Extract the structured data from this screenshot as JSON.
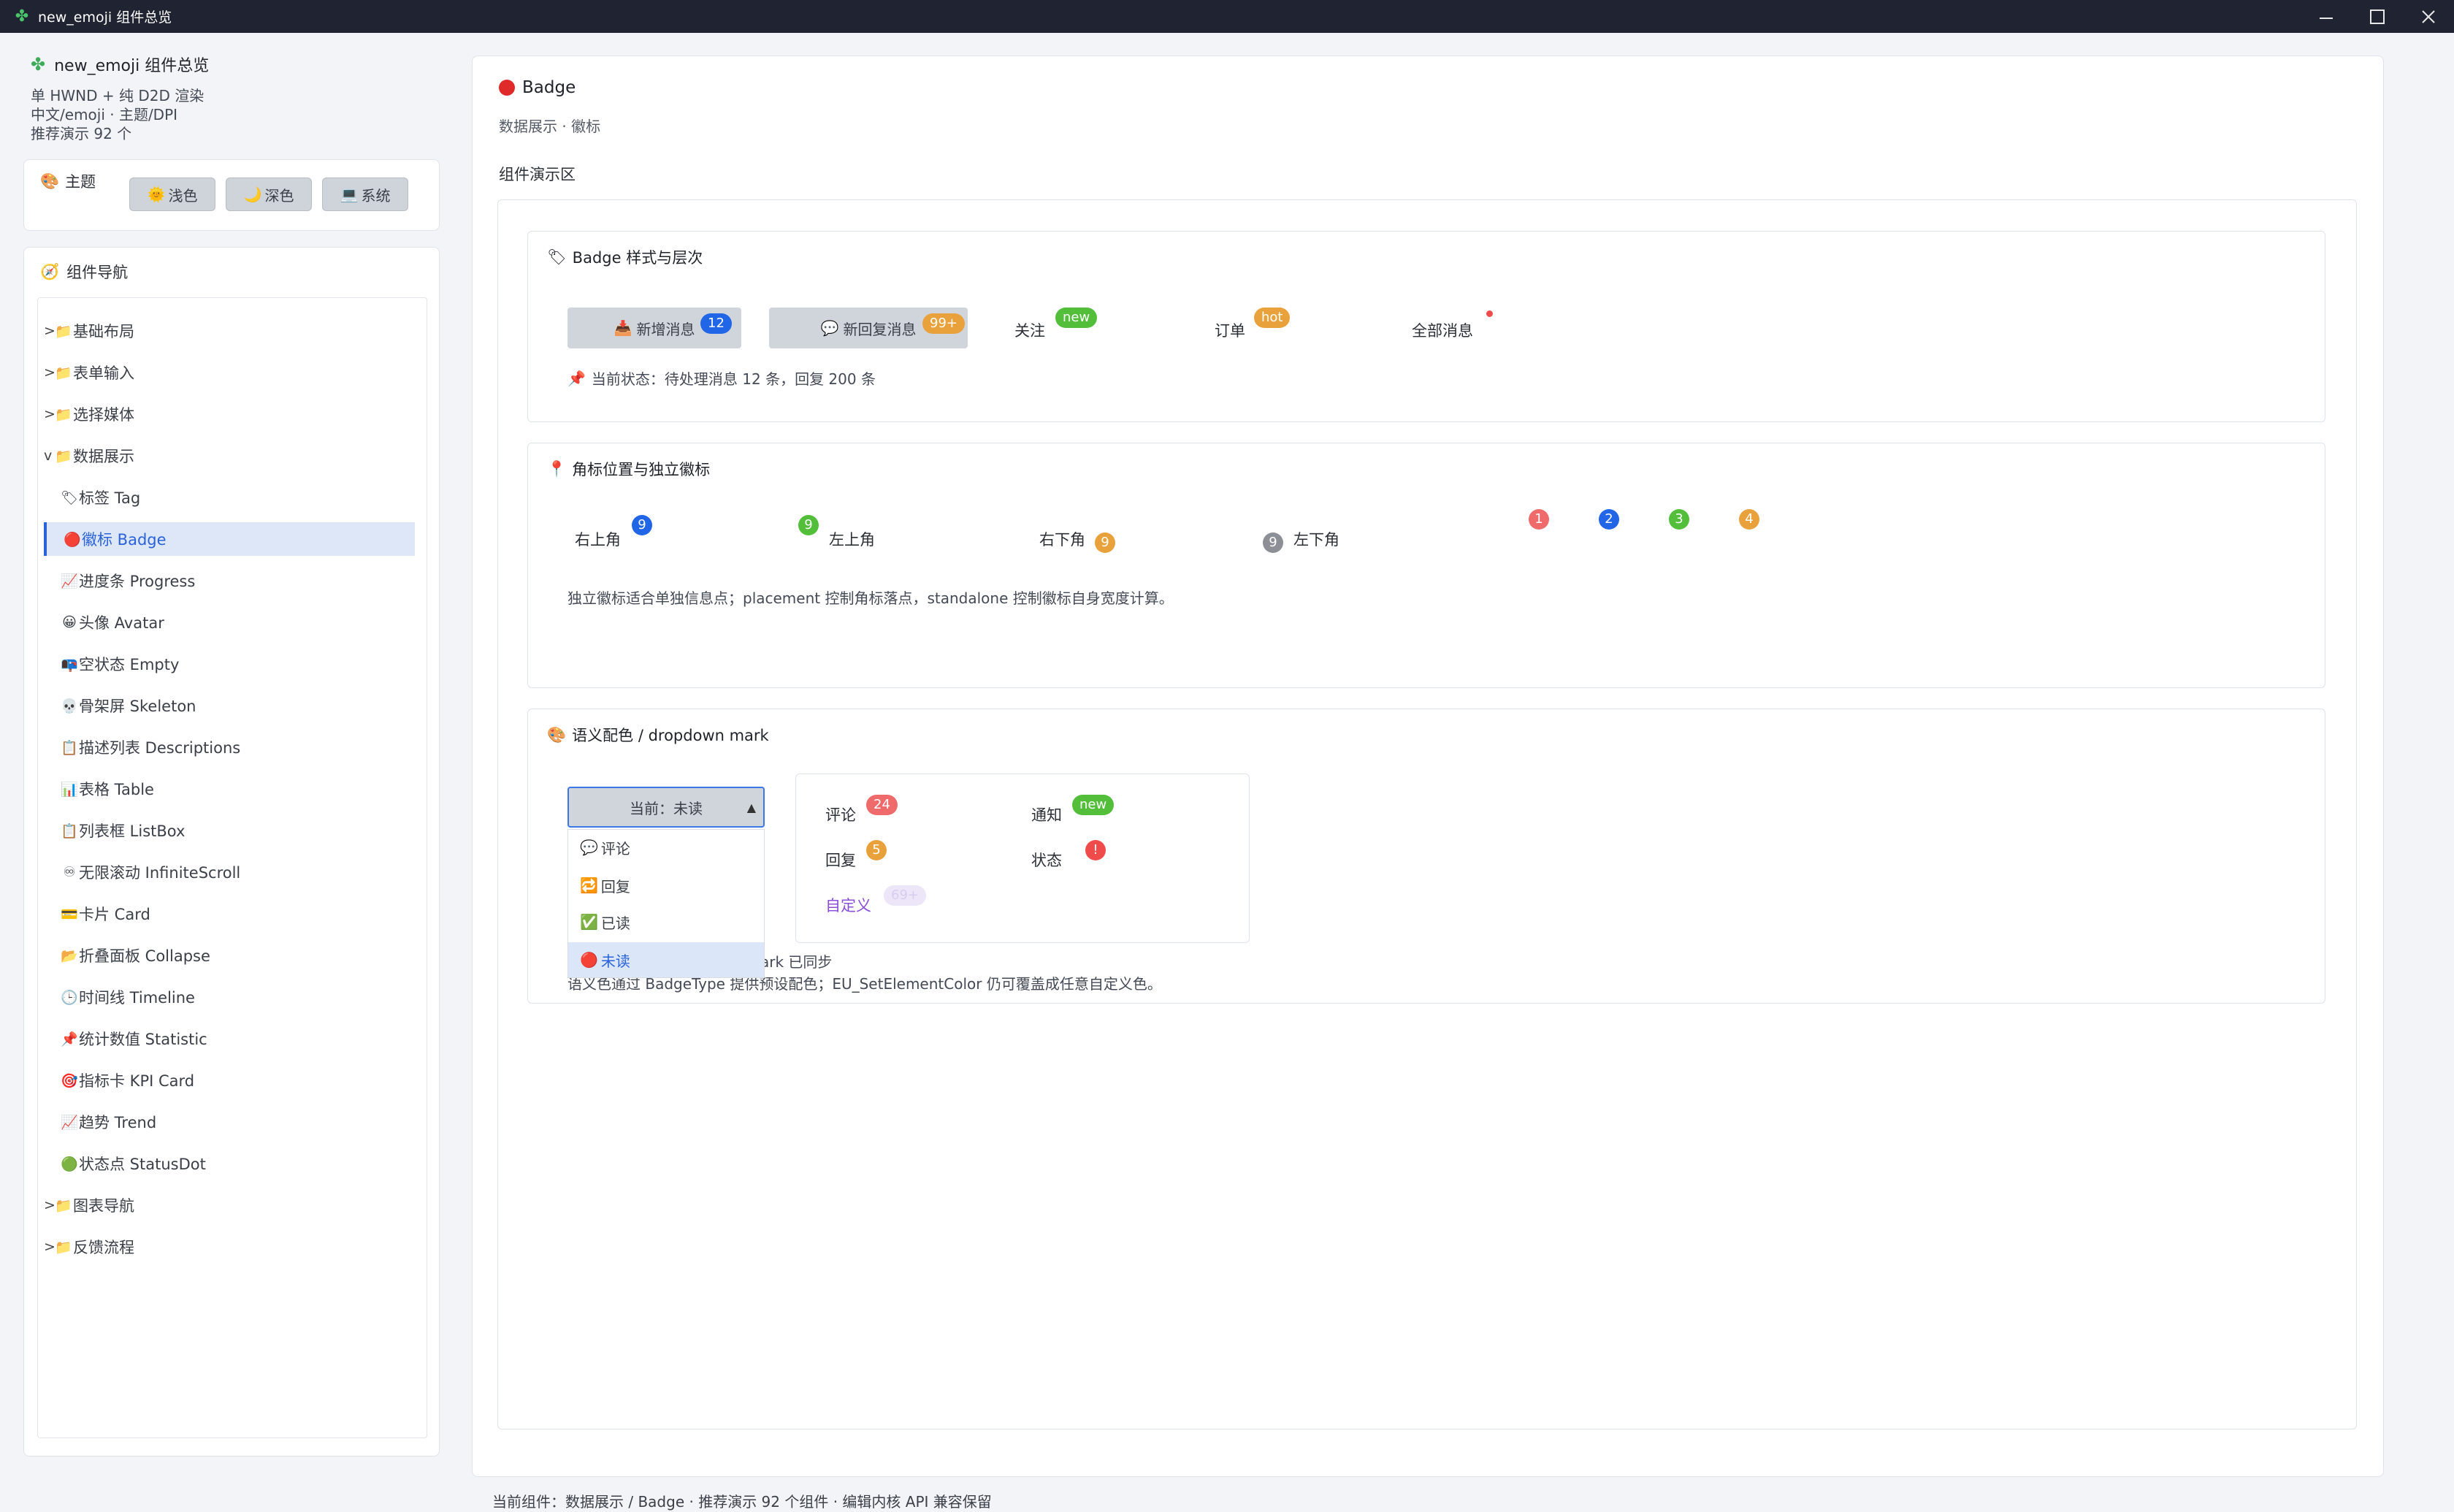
{
  "window": {
    "title": "new_emoji 组件总览",
    "controls": {
      "minimize": "—",
      "maximize": "☐",
      "close": "✕"
    }
  },
  "sidebar": {
    "app_name": "new_emoji 组件总览",
    "lines": [
      "单 HWND + 纯 D2D 渲染",
      "中文/emoji · 主题/DPI",
      "推荐演示 92 个"
    ],
    "theme": {
      "label": "主题",
      "buttons": [
        {
          "icon": "🌞",
          "label": "浅色"
        },
        {
          "icon": "🌙",
          "label": "深色"
        },
        {
          "icon": "💻",
          "label": "系统"
        }
      ]
    },
    "nav": {
      "title": "组件导航",
      "items": [
        {
          "chev": ">",
          "icon": "📁",
          "label": "基础布局"
        },
        {
          "chev": ">",
          "icon": "📁",
          "label": "表单输入"
        },
        {
          "chev": ">",
          "icon": "📁",
          "label": "选择媒体"
        },
        {
          "chev": "v",
          "icon": "📁",
          "label": "数据展示"
        },
        {
          "chev": "",
          "icon": "🏷",
          "label": "标签 Tag"
        },
        {
          "chev": "",
          "icon": "🔴",
          "label": "徽标 Badge"
        },
        {
          "chev": "",
          "icon": "📈",
          "label": "进度条 Progress"
        },
        {
          "chev": "",
          "icon": "😀",
          "label": "头像 Avatar"
        },
        {
          "chev": "",
          "icon": "📭",
          "label": "空状态 Empty"
        },
        {
          "chev": "",
          "icon": "💀",
          "label": "骨架屏 Skeleton"
        },
        {
          "chev": "",
          "icon": "📋",
          "label": "描述列表 Descriptions"
        },
        {
          "chev": "",
          "icon": "📊",
          "label": "表格 Table"
        },
        {
          "chev": "",
          "icon": "📋",
          "label": "列表框 ListBox"
        },
        {
          "chev": "",
          "icon": "♾",
          "label": "无限滚动 InfiniteScroll"
        },
        {
          "chev": "",
          "icon": "💳",
          "label": "卡片 Card"
        },
        {
          "chev": "",
          "icon": "📂",
          "label": "折叠面板 Collapse"
        },
        {
          "chev": "",
          "icon": "🕒",
          "label": "时间线 Timeline"
        },
        {
          "chev": "",
          "icon": "📌",
          "label": "统计数值 Statistic"
        },
        {
          "chev": "",
          "icon": "🎯",
          "label": "指标卡 KPI Card"
        },
        {
          "chev": "",
          "icon": "📈",
          "label": "趋势 Trend"
        },
        {
          "chev": "",
          "icon": "🟢",
          "label": "状态点 StatusDot"
        },
        {
          "chev": ">",
          "icon": "📁",
          "label": "图表导航"
        },
        {
          "chev": ">",
          "icon": "📁",
          "label": "反馈流程"
        }
      ],
      "active_index": 5
    }
  },
  "main": {
    "title": "Badge",
    "subtitle": "数据展示 · 徽标",
    "demo_label": "组件演示区",
    "card1": {
      "title": "Badge 样式与层次",
      "btn1": {
        "icon": "📥",
        "label": "新增消息",
        "badge": "12"
      },
      "btn2": {
        "icon": "💬",
        "label": "新回复消息",
        "badge": "99+"
      },
      "follow": {
        "label": "关注",
        "badge": "new"
      },
      "order": {
        "label": "订单",
        "badge": "hot"
      },
      "all": {
        "label": "全部消息"
      },
      "status": "当前状态：待处理消息 12 条，回复 200 条"
    },
    "card2": {
      "title": "角标位置与独立徽标",
      "positions": [
        {
          "label": "右上角",
          "value": "9"
        },
        {
          "label": "左上角",
          "value": "9"
        },
        {
          "label": "右下角",
          "value": "9"
        },
        {
          "label": "左下角",
          "value": "9"
        }
      ],
      "standalone": [
        "1",
        "2",
        "3",
        "4"
      ],
      "note": "独立徽标适合单独信息点；placement 控制角标落点，standalone 控制徽标自身宽度计算。"
    },
    "card3": {
      "title": "语义配色 / dropdown mark",
      "dropdown": {
        "value": "当前：未读",
        "arrow": "▲"
      },
      "options": [
        {
          "icon": "💬",
          "label": "评论"
        },
        {
          "icon": "🔁",
          "label": "回复"
        },
        {
          "icon": "✅",
          "label": "已读"
        },
        {
          "icon": "🔴",
          "label": "未读"
        }
      ],
      "marks": {
        "comment": {
          "label": "评论",
          "badge": "24"
        },
        "notice": {
          "label": "通知",
          "badge": "new"
        },
        "reply": {
          "label": "回复",
          "badge": "5"
        },
        "state": {
          "label": "状态",
          "badge": "!"
        },
        "custom": {
          "label": "自定义",
          "badge": "69+"
        }
      },
      "sync_note": "ark 已同步",
      "note": "语义色通过 BadgeType 提供预设配色；EU_SetElementColor 仍可覆盖成任意自定义色。"
    }
  },
  "statusbar": "当前组件：数据展示 / Badge · 推荐演示 92 个组件 · 编辑内核 API 兼容保留",
  "colors": {
    "blue": "#2166e6",
    "orange": "#e9a23b",
    "green": "#52be3a",
    "red": "#ef6b6b",
    "gray": "#8c8f96",
    "purple": "#8a4fd8",
    "accent": "#2a62d9"
  }
}
